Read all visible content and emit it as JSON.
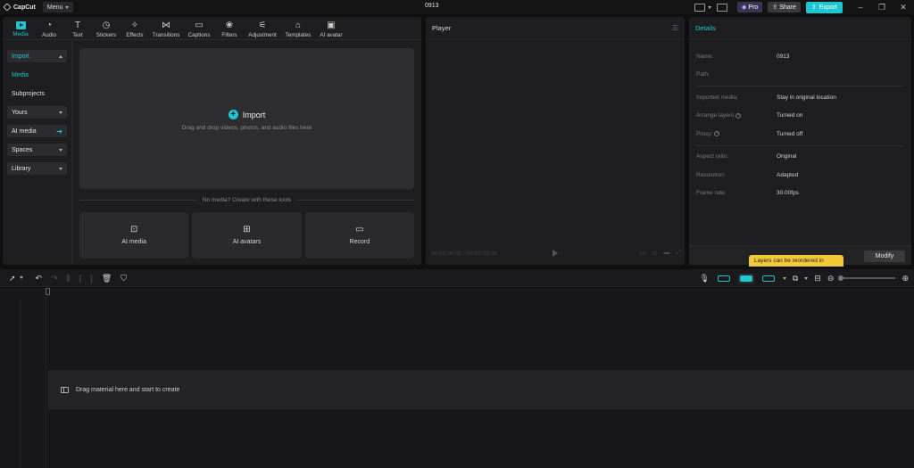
{
  "app": {
    "name": "CapCut",
    "menu_label": "Menu",
    "project_title": "0913"
  },
  "titlebar": {
    "pro_label": "Pro",
    "share_label": "Share",
    "export_label": "Export"
  },
  "toolbar": {
    "tabs": [
      {
        "label": "Media",
        "icon": "media-icon"
      },
      {
        "label": "Audio",
        "icon": "audio-icon"
      },
      {
        "label": "Text",
        "icon": "text-icon"
      },
      {
        "label": "Stickers",
        "icon": "stickers-icon"
      },
      {
        "label": "Effects",
        "icon": "effects-icon"
      },
      {
        "label": "Transitions",
        "icon": "transitions-icon"
      },
      {
        "label": "Captions",
        "icon": "captions-icon"
      },
      {
        "label": "Filters",
        "icon": "filters-icon"
      },
      {
        "label": "Adjustment",
        "icon": "adjustment-icon"
      },
      {
        "label": "Templates",
        "icon": "templates-icon"
      },
      {
        "label": "AI avatar",
        "icon": "ai-avatar-icon"
      }
    ],
    "active_tab": "Media"
  },
  "side_nav": {
    "import": "Import",
    "media": "Media",
    "subprojects": "Subprojects",
    "yours": "Yours",
    "ai_media": "AI media",
    "spaces": "Spaces",
    "library": "Library"
  },
  "import_area": {
    "label": "Import",
    "hint": "Drag and drop videos, photos, and audio files here"
  },
  "tools": {
    "prompt": "No media? Create with these tools",
    "items": [
      {
        "label": "AI media",
        "icon": "ai-media-icon"
      },
      {
        "label": "AI avatars",
        "icon": "ai-avatars-icon"
      },
      {
        "label": "Record",
        "icon": "record-icon"
      }
    ]
  },
  "player": {
    "title": "Player",
    "timecode": "00:00:00:00 / 00:00:00:00"
  },
  "details": {
    "title": "Details",
    "rows": [
      {
        "label": "Name:",
        "value": "0913"
      },
      {
        "label": "Path:",
        "value": ""
      },
      {
        "label": "Imported media:",
        "value": "Stay in original location"
      },
      {
        "label": "Arrange layers",
        "value": "Turned on"
      },
      {
        "label": "Proxy:",
        "value": "Turned off"
      },
      {
        "label": "Aspect ratio:",
        "value": "Original"
      },
      {
        "label": "Resolution:",
        "value": "Adapted"
      },
      {
        "label": "Frame rate:",
        "value": "30.00fps"
      }
    ],
    "tooltip": "Layers can be reordered in",
    "modify_label": "Modify"
  },
  "timeline": {
    "hint": "Drag material here and start to create"
  },
  "colors": {
    "accent": "#1fc7d1",
    "tooltip": "#f2c83b",
    "background": "#0f0f10",
    "panel": "#1e1e20"
  }
}
